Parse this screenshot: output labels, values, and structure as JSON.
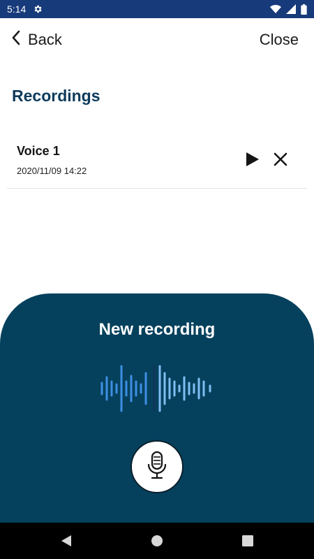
{
  "status_bar": {
    "time": "5:14",
    "icons": [
      "settings-icon",
      "wifi-icon",
      "signal-icon",
      "battery-icon"
    ],
    "background": "#173a7a"
  },
  "header": {
    "back_label": "Back",
    "close_label": "Close"
  },
  "recordings": {
    "title": "Recordings",
    "items": [
      {
        "name": "Voice 1",
        "date": "2020/11/09 14:22",
        "actions": [
          "play-icon",
          "close-icon"
        ]
      }
    ]
  },
  "recorder": {
    "title": "New recording",
    "panel_color": "#05415d",
    "wave_colors": [
      "#3e8fe4",
      "#7fbef2",
      "#10365a"
    ],
    "mic_icon": "microphone-icon"
  },
  "nav_bar": {
    "buttons": [
      "back-triangle-icon",
      "home-circle-icon",
      "recents-square-icon"
    ]
  },
  "colors": {
    "title": "#0e3b5c",
    "text": "#151515"
  }
}
